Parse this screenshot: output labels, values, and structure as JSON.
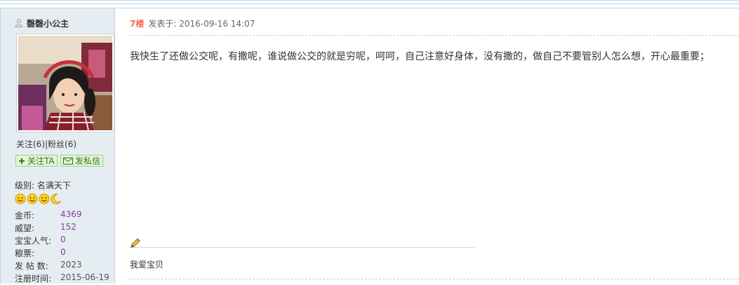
{
  "user": {
    "name": "磬磬小公主",
    "follow_text": "关注(6)",
    "separator": "|",
    "fans_text": "粉丝(6)",
    "follow_button": "关注TA",
    "message_button": "发私信",
    "level_text": "级别: 名满天下",
    "level_icons": [
      "smiley-icon",
      "smiley-icon",
      "smiley-icon",
      "moon-icon"
    ],
    "stats": [
      {
        "label": "金币:",
        "value": "4369"
      },
      {
        "label": "威望:",
        "value": "152"
      },
      {
        "label": "宝宝人气:",
        "value": "0"
      },
      {
        "label": "粮票:",
        "value": "0"
      },
      {
        "label": "发 帖 数:",
        "value": "2023"
      },
      {
        "label": "注册时间:",
        "value": "2015-06-19"
      }
    ]
  },
  "post": {
    "floor": "7楼",
    "posted_at": "发表于: 2016-09-16 14:07",
    "body": "我快生了还做公交呢，有撒呢，谁说做公交的就是穷呢，呵呵，自己注意好身体，没有撒的，做自己不要管别人怎么想，开心最重要；",
    "signature": "我爱宝贝"
  },
  "colors": {
    "sidebar_bg": "#e5edf2",
    "border": "#c2d5e3",
    "floor": "#f26c4f",
    "stat_value": "#8a3c9c",
    "button_green": "#2d7a12"
  }
}
